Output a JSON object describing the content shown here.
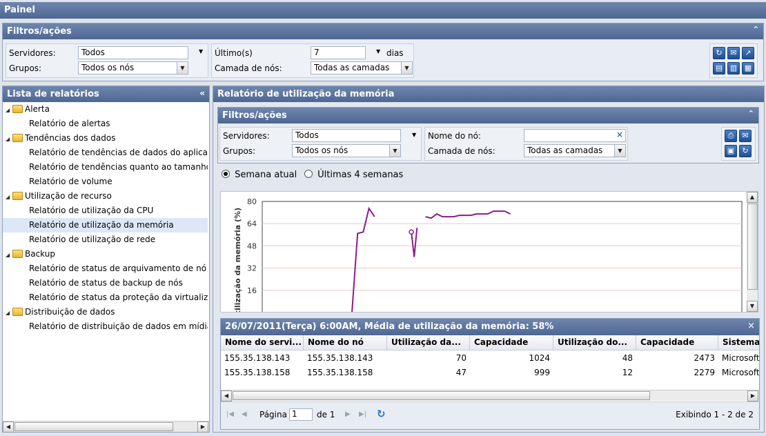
{
  "window": {
    "title": "Painel"
  },
  "filters": {
    "title": "Filtros/ações",
    "servers_label": "Servidores:",
    "servers_value": "Todos",
    "groups_label": "Grupos:",
    "groups_value": "Todos os nós",
    "last_label": "Último(s)",
    "last_value": "7",
    "days_label": "dias",
    "layer_label": "Camada de nós:",
    "layer_value": "Todas as camadas"
  },
  "reports": {
    "title": "Lista de relatórios",
    "tree": [
      {
        "label": "Alerta",
        "type": "folder"
      },
      {
        "label": "Relatório de alertas",
        "type": "item"
      },
      {
        "label": "Tendências dos dados",
        "type": "folder"
      },
      {
        "label": "Relatório de tendências de dados do aplicativ",
        "type": "item"
      },
      {
        "label": "Relatório de tendências quanto ao tamanho d",
        "type": "item"
      },
      {
        "label": "Relatório de volume",
        "type": "item"
      },
      {
        "label": "Utilização de recurso",
        "type": "folder"
      },
      {
        "label": "Relatório de utilização da CPU",
        "type": "item"
      },
      {
        "label": "Relatório de utilização da memória",
        "type": "item",
        "selected": true
      },
      {
        "label": "Relatório de utilização de rede",
        "type": "item"
      },
      {
        "label": "Backup",
        "type": "folder"
      },
      {
        "label": "Relatório de status de arquivamento de nó",
        "type": "item"
      },
      {
        "label": "Relatório de status de backup de nós",
        "type": "item"
      },
      {
        "label": "Relatório de status da proteção da virtualizaç",
        "type": "item"
      },
      {
        "label": "Distribuição de dados",
        "type": "folder"
      },
      {
        "label": "Relatório de distribuição de dados em mídias",
        "type": "item"
      }
    ]
  },
  "memreport": {
    "title": "Relatório de utilização da memória",
    "filters": {
      "title": "Filtros/ações",
      "servers_label": "Servidores:",
      "servers_value": "Todos",
      "groups_label": "Grupos:",
      "groups_value": "Todos os nós",
      "node_label": "Nome do nó:",
      "node_value": "",
      "layer_label": "Camada de nós:",
      "layer_value": "Todas as camadas"
    },
    "radio_current": "Semana atual",
    "radio_last4": "Últimas 4 semanas",
    "detail_title": "26/07/2011(Terça) 6:00AM, Média de utilização da memória: 58%",
    "table": {
      "columns": [
        "Nome do servi...",
        "Nome do nó",
        "Utilização da...",
        "Capacidade",
        "Utilização do...",
        "Capacidade",
        "Sistema"
      ],
      "rows": [
        [
          "155.35.138.143",
          "155.35.138.143",
          "70",
          "1024",
          "48",
          "2473",
          "Microsoft"
        ],
        [
          "155.35.138.158",
          "155.35.138.158",
          "47",
          "999",
          "12",
          "2279",
          "Microsoft"
        ]
      ]
    },
    "pager": {
      "page_label": "Página",
      "page_value": "1",
      "of_label": "de 1",
      "showing": "Exibindo 1 - 2 de 2"
    }
  },
  "chart_data": {
    "type": "line",
    "ylabel": "Utilização da memória (%)",
    "ylim": [
      0,
      80
    ],
    "yticks": [
      16,
      32,
      48,
      64,
      80
    ],
    "series": [
      {
        "x": [
          0,
          1,
          2,
          3,
          4
        ],
        "y": [
          0,
          57,
          58,
          75,
          69
        ]
      },
      {
        "x": [
          10.5,
          11,
          11.5
        ],
        "y": [
          58,
          40,
          61
        ]
      },
      {
        "x": [
          13,
          14,
          15,
          16,
          17,
          18,
          19,
          20,
          21,
          22,
          23,
          24,
          25,
          26,
          27
        ],
        "y": [
          69,
          68,
          71,
          69,
          69,
          69,
          70,
          70,
          70,
          71,
          71,
          71,
          73,
          73,
          73
        ]
      },
      {
        "x": [
          27,
          28
        ],
        "y": [
          73,
          71
        ]
      }
    ],
    "colors": {
      "line": "#8b1a8b",
      "grid": "#f0c6c6"
    }
  }
}
